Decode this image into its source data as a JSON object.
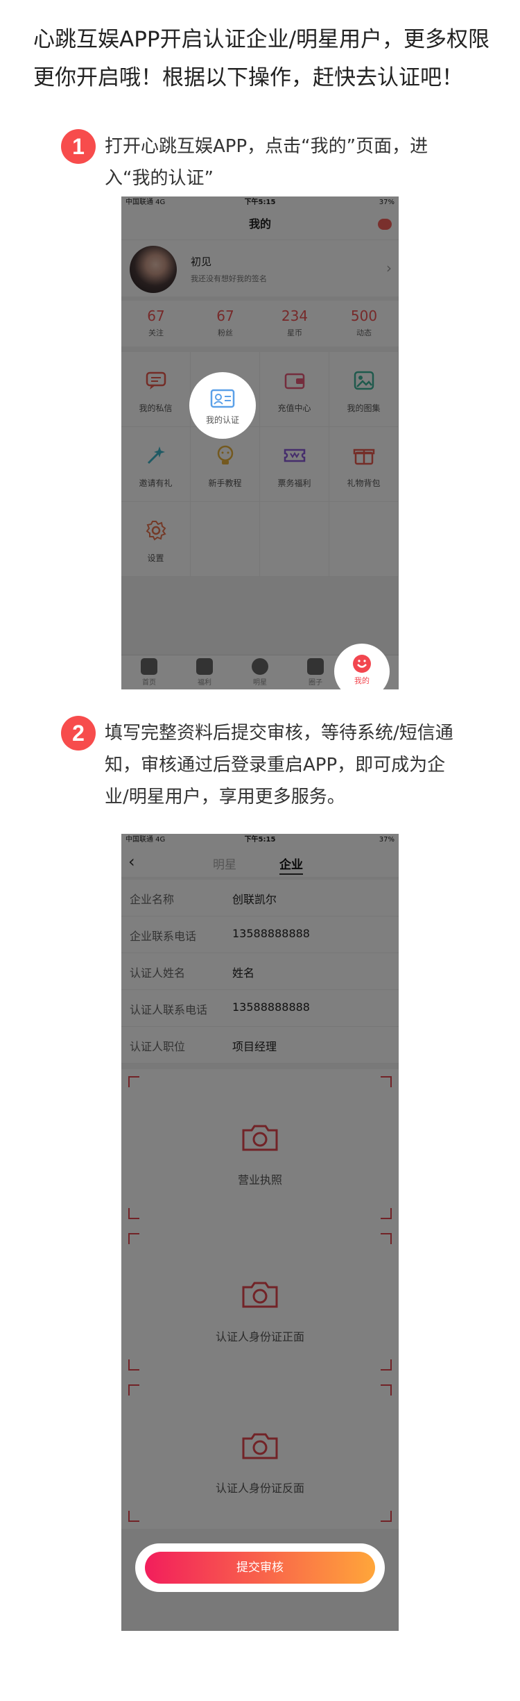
{
  "intro": "心跳互娱APP开启认证企业/明星用户，更多权限更你开启哦！根据以下操作，赶快去认证吧！",
  "steps": [
    {
      "num": "1",
      "text": "打开心跳互娱APP，点击“我的”页面，进入“我的认证”"
    },
    {
      "num": "2",
      "text": "填写完整资料后提交审核，等待系统/短信通知，审核通过后登录重启APP，即可成为企业/明星用户，享用更多服务。"
    }
  ],
  "status_bar": {
    "carrier": "中国联通 4G",
    "time": "下午5:15",
    "battery": "37%"
  },
  "phone1": {
    "title": "我的",
    "profile": {
      "name": "初见",
      "signature": "我还没有想好我的签名"
    },
    "stats": [
      {
        "value": "67",
        "label": "关注"
      },
      {
        "value": "67",
        "label": "粉丝"
      },
      {
        "value": "234",
        "label": "星币"
      },
      {
        "value": "500",
        "label": "动态"
      }
    ],
    "grid": [
      {
        "label": "我的私信",
        "icon": "message-icon",
        "color": "#e85a4f"
      },
      {
        "label": "我的认证",
        "icon": "id-card-icon",
        "color": "#5aa0e8"
      },
      {
        "label": "充值中心",
        "icon": "wallet-icon",
        "color": "#e85a7a"
      },
      {
        "label": "我的图集",
        "icon": "image-icon",
        "color": "#3fb59a"
      },
      {
        "label": "邀请有礼",
        "icon": "wand-icon",
        "color": "#3fb5c8"
      },
      {
        "label": "新手教程",
        "icon": "bulb-icon",
        "color": "#e8b33f"
      },
      {
        "label": "票务福利",
        "icon": "ticket-icon",
        "color": "#8a5ad8"
      },
      {
        "label": "礼物背包",
        "icon": "gift-icon",
        "color": "#e85a4f"
      },
      {
        "label": "设置",
        "icon": "gear-icon",
        "color": "#e8734f"
      }
    ],
    "tabs": [
      {
        "label": "首页",
        "icon": "home-icon"
      },
      {
        "label": "福利",
        "icon": "gift-icon"
      },
      {
        "label": "明星",
        "icon": "heart-icon"
      },
      {
        "label": "圈子",
        "icon": "shield-icon"
      },
      {
        "label": "我的",
        "icon": "smile-icon"
      }
    ]
  },
  "phone2": {
    "tabs": [
      "明星",
      "企业"
    ],
    "fields": [
      {
        "label": "企业名称",
        "value": "创联凯尔"
      },
      {
        "label": "企业联系电话",
        "value": "13588888888"
      },
      {
        "label": "认证人姓名",
        "value": "姓名"
      },
      {
        "label": "认证人联系电话",
        "value": "13588888888"
      },
      {
        "label": "认证人职位",
        "value": "项目经理"
      }
    ],
    "uploads": [
      "营业执照",
      "认证人身份证正面",
      "认证人身份证反面"
    ],
    "submit": "提交审核"
  },
  "colors": {
    "accent": "#f74c4c",
    "gradient_start": "#f21e5c",
    "gradient_end": "#ffa63a"
  }
}
